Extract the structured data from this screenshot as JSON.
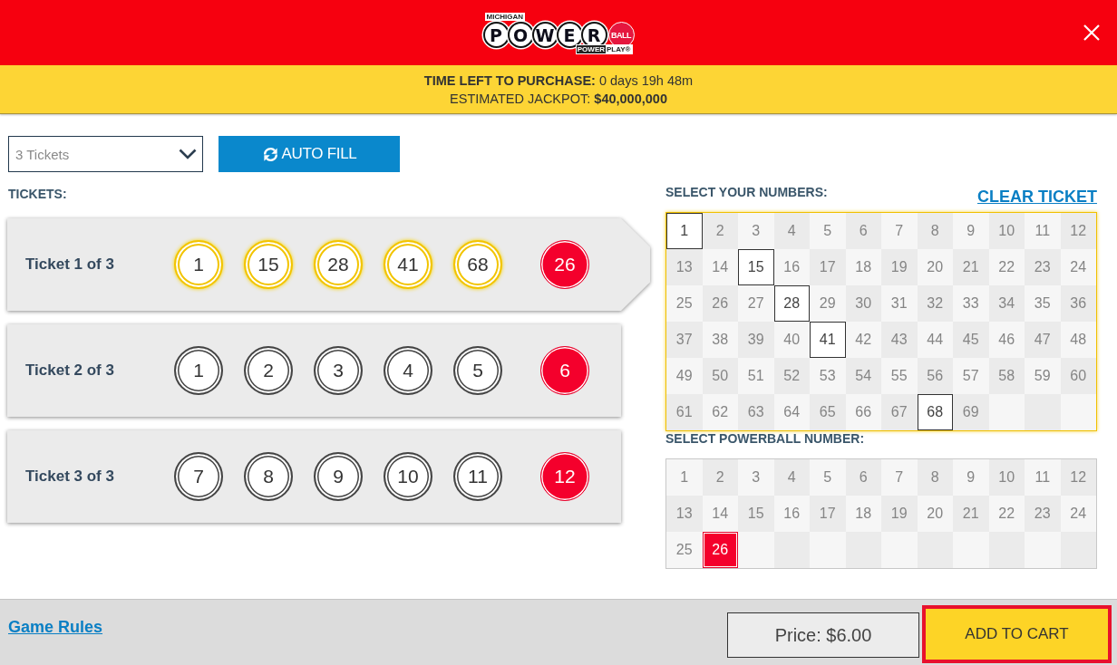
{
  "header": {
    "logo": {
      "region": "MICHIGAN",
      "letters": [
        "P",
        "O",
        "W",
        "E",
        "R"
      ],
      "ball": "BALL",
      "sub": [
        "POWER",
        "PLAY®"
      ]
    }
  },
  "info_bar": {
    "lines": [
      "**TIME LEFT TO PURCHASE:** 0 days 19h 48m",
      "ESTIMATED JACKPOT: **$40,000,000**"
    ]
  },
  "controls": {
    "ticket_count": {
      "value": "3 Tickets"
    },
    "auto_fill": "AUTO FILL"
  },
  "tickets_label": "TICKETS:",
  "tickets": [
    {
      "label": "Ticket 1 of 3",
      "selected": true,
      "numbers": [
        "1",
        "15",
        "28",
        "41",
        "68"
      ],
      "powerball": "26"
    },
    {
      "label": "Ticket 2 of 3",
      "selected": false,
      "numbers": [
        "1",
        "2",
        "3",
        "4",
        "5"
      ],
      "powerball": "6"
    },
    {
      "label": "Ticket 3 of 3",
      "selected": false,
      "numbers": [
        "7",
        "8",
        "9",
        "10",
        "11"
      ],
      "powerball": "12"
    }
  ],
  "number_picker": {
    "title": "SELECT YOUR NUMBERS:",
    "clear": "CLEAR TICKET",
    "cells": [
      {
        "label": "1",
        "selected": true
      },
      {
        "label": "2",
        "selected": false
      },
      {
        "label": "3",
        "selected": false
      },
      {
        "label": "4",
        "selected": false
      },
      {
        "label": "5",
        "selected": false
      },
      {
        "label": "6",
        "selected": false
      },
      {
        "label": "7",
        "selected": false
      },
      {
        "label": "8",
        "selected": false
      },
      {
        "label": "9",
        "selected": false
      },
      {
        "label": "10",
        "selected": false
      },
      {
        "label": "11",
        "selected": false
      },
      {
        "label": "12",
        "selected": false
      },
      {
        "label": "13",
        "selected": false
      },
      {
        "label": "14",
        "selected": false
      },
      {
        "label": "15",
        "selected": true
      },
      {
        "label": "16",
        "selected": false
      },
      {
        "label": "17",
        "selected": false
      },
      {
        "label": "18",
        "selected": false
      },
      {
        "label": "19",
        "selected": false
      },
      {
        "label": "20",
        "selected": false
      },
      {
        "label": "21",
        "selected": false
      },
      {
        "label": "22",
        "selected": false
      },
      {
        "label": "23",
        "selected": false
      },
      {
        "label": "24",
        "selected": false
      },
      {
        "label": "25",
        "selected": false
      },
      {
        "label": "26",
        "selected": false
      },
      {
        "label": "27",
        "selected": false
      },
      {
        "label": "28",
        "selected": true
      },
      {
        "label": "29",
        "selected": false
      },
      {
        "label": "30",
        "selected": false
      },
      {
        "label": "31",
        "selected": false
      },
      {
        "label": "32",
        "selected": false
      },
      {
        "label": "33",
        "selected": false
      },
      {
        "label": "34",
        "selected": false
      },
      {
        "label": "35",
        "selected": false
      },
      {
        "label": "36",
        "selected": false
      },
      {
        "label": "37",
        "selected": false
      },
      {
        "label": "38",
        "selected": false
      },
      {
        "label": "39",
        "selected": false
      },
      {
        "label": "40",
        "selected": false
      },
      {
        "label": "41",
        "selected": true
      },
      {
        "label": "42",
        "selected": false
      },
      {
        "label": "43",
        "selected": false
      },
      {
        "label": "44",
        "selected": false
      },
      {
        "label": "45",
        "selected": false
      },
      {
        "label": "46",
        "selected": false
      },
      {
        "label": "47",
        "selected": false
      },
      {
        "label": "48",
        "selected": false
      },
      {
        "label": "49",
        "selected": false
      },
      {
        "label": "50",
        "selected": false
      },
      {
        "label": "51",
        "selected": false
      },
      {
        "label": "52",
        "selected": false
      },
      {
        "label": "53",
        "selected": false
      },
      {
        "label": "54",
        "selected": false
      },
      {
        "label": "55",
        "selected": false
      },
      {
        "label": "56",
        "selected": false
      },
      {
        "label": "57",
        "selected": false
      },
      {
        "label": "58",
        "selected": false
      },
      {
        "label": "59",
        "selected": false
      },
      {
        "label": "60",
        "selected": false
      },
      {
        "label": "61",
        "selected": false
      },
      {
        "label": "62",
        "selected": false
      },
      {
        "label": "63",
        "selected": false
      },
      {
        "label": "64",
        "selected": false
      },
      {
        "label": "65",
        "selected": false
      },
      {
        "label": "66",
        "selected": false
      },
      {
        "label": "67",
        "selected": false
      },
      {
        "label": "68",
        "selected": true
      },
      {
        "label": "69",
        "selected": false
      }
    ]
  },
  "powerball_picker": {
    "title": "SELECT POWERBALL NUMBER:",
    "cells": [
      {
        "label": "1",
        "selected": false
      },
      {
        "label": "2",
        "selected": false
      },
      {
        "label": "3",
        "selected": false
      },
      {
        "label": "4",
        "selected": false
      },
      {
        "label": "5",
        "selected": false
      },
      {
        "label": "6",
        "selected": false
      },
      {
        "label": "7",
        "selected": false
      },
      {
        "label": "8",
        "selected": false
      },
      {
        "label": "9",
        "selected": false
      },
      {
        "label": "10",
        "selected": false
      },
      {
        "label": "11",
        "selected": false
      },
      {
        "label": "12",
        "selected": false
      },
      {
        "label": "13",
        "selected": false
      },
      {
        "label": "14",
        "selected": false
      },
      {
        "label": "15",
        "selected": false
      },
      {
        "label": "16",
        "selected": false
      },
      {
        "label": "17",
        "selected": false
      },
      {
        "label": "18",
        "selected": false
      },
      {
        "label": "19",
        "selected": false
      },
      {
        "label": "20",
        "selected": false
      },
      {
        "label": "21",
        "selected": false
      },
      {
        "label": "22",
        "selected": false
      },
      {
        "label": "23",
        "selected": false
      },
      {
        "label": "24",
        "selected": false
      },
      {
        "label": "25",
        "selected": false
      },
      {
        "label": "26",
        "selected": true
      }
    ]
  },
  "footer": {
    "rules_link": "Game Rules",
    "price": "Price: $6.00",
    "add_to_cart": {
      "label": "ADD TO CART",
      "highlighted": true
    }
  }
}
